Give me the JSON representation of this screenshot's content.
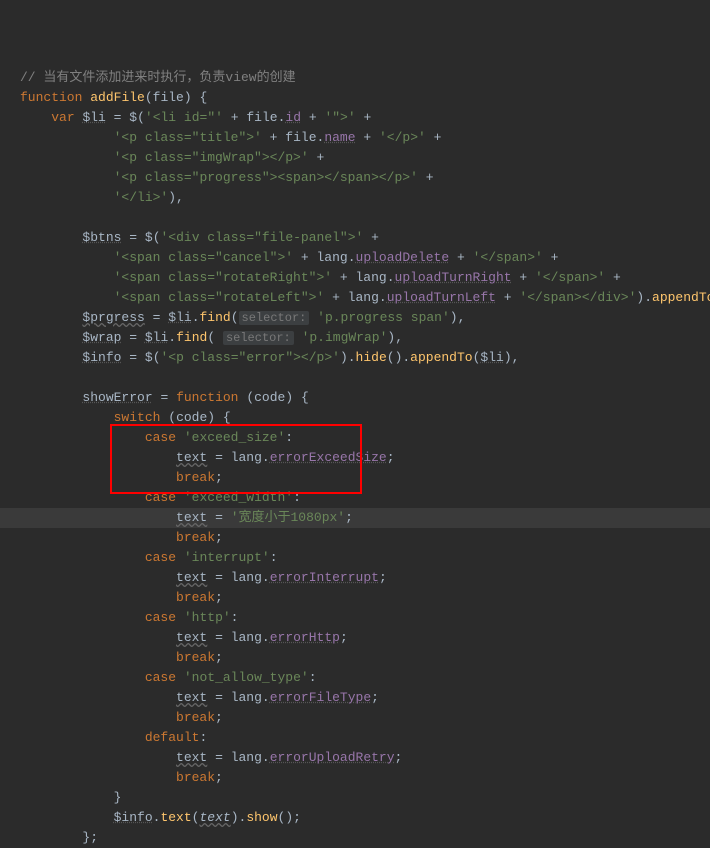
{
  "code": {
    "comment": "// 当有文件添加进来时执行，负责view的创建",
    "fn_kw": "function",
    "fn_name": "addFile",
    "fn_param": "file",
    "var_kw": "var",
    "li_var": "$li",
    "jq": "$",
    "li_s1a": "'<li id=\"'",
    "li_s1b": "file",
    "li_s1c": "id",
    "li_s1d": "'\">'",
    "li_s2a": "'<p class=\"title\">'",
    "li_s2b": "file",
    "li_s2c": "name",
    "li_s2d": "'</p>'",
    "li_s3": "'<p class=\"imgWrap\"></p>'",
    "li_s4": "'<p class=\"progress\"><span></span></p>'",
    "li_s5": "'</li>'",
    "btns_var": "$btns",
    "btns_s1": "'<div class=\"file-panel\">'",
    "btns_s2a": "'<span class=\"cancel\">'",
    "btns_lang": "lang",
    "btns_s2b": "uploadDelete",
    "btns_s2c": "'</span>'",
    "btns_s3a": "'<span class=\"rotateRight\">'",
    "btns_s3b": "uploadTurnRight",
    "btns_s3c": "'</span>'",
    "btns_s4a": "'<span class=\"rotateLeft\">'",
    "btns_s4b": "uploadTurnLeft",
    "btns_s4c": "'</span></div>'",
    "appendTo": "appendTo",
    "prg_var": "$prgress",
    "find": "find",
    "hint_sel": "selector:",
    "prg_sel": "'p.progress span'",
    "wrap_var": "$wrap",
    "wrap_sel": "'p.imgWrap'",
    "info_var": "$info",
    "info_s": "'<p class=\"error\"></p>'",
    "hide": "hide",
    "showErr_var": "showError",
    "anon_param": "code",
    "switch_kw": "switch",
    "case_kw": "case",
    "break_kw": "break",
    "default_kw": "default",
    "text_var": "text",
    "c1": "'exceed_size'",
    "c1v": "errorExceedSize",
    "c2": "'exceed_width'",
    "c2v": "'宽度小于1080px'",
    "c3": "'interrupt'",
    "c3v": "errorInterrupt",
    "c4": "'http'",
    "c4v": "errorHttp",
    "c5": "'not_allow_type'",
    "c5v": "errorFileType",
    "c6v": "errorUploadRetry",
    "text_m": "text",
    "show_m": "show"
  }
}
